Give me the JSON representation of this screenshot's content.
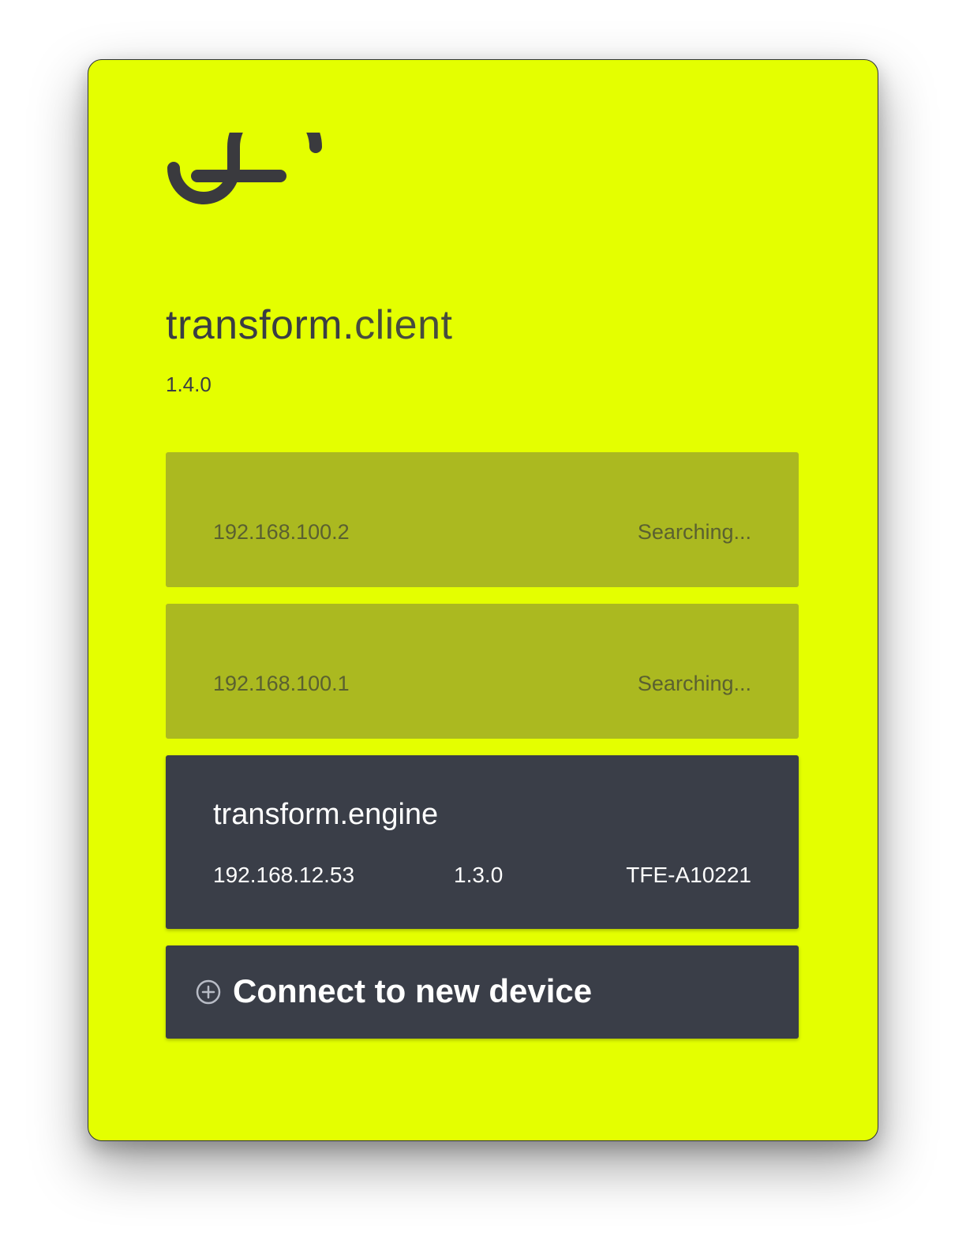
{
  "app": {
    "title_bold": "transform.",
    "title_light": "client",
    "version": "1.4.0",
    "logo_icon": "transform-logo-icon",
    "accent_color": "#e4ff00",
    "dark_color": "#3a3e48"
  },
  "devices": [
    {
      "state": "searching",
      "ip": "192.168.100.2",
      "status": "Searching..."
    },
    {
      "state": "searching",
      "ip": "192.168.100.1",
      "status": "Searching..."
    },
    {
      "state": "connected",
      "name_bold": "transform.",
      "name_light": "engine",
      "ip": "192.168.12.53",
      "version": "1.3.0",
      "serial": "TFE-A10221"
    }
  ],
  "connect_button": {
    "icon": "plus-circle-icon",
    "label": "Connect to new device"
  }
}
